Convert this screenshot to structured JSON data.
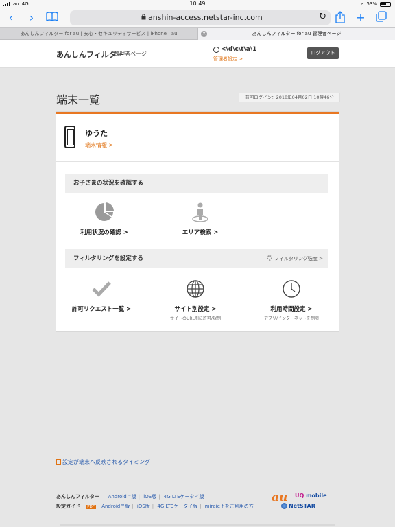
{
  "statusbar": {
    "carrier": "au",
    "network": "4G",
    "time": "10:49",
    "battery": "53%"
  },
  "browser": {
    "url": "anshin-access.netstar-inc.com",
    "tabs": [
      {
        "title": "あんしんフィルター for au | 安心・セキュリティサービス | iPhone | au"
      },
      {
        "title": "あんしんフィルター for au 管理者ページ"
      }
    ]
  },
  "header": {
    "logo": "あんしんフィルター",
    "subtitle": "管理者ページ",
    "user_name": "<\\d\\c\\t\\a\\1",
    "admin_settings": "管理者設定 >",
    "logout": "ログアウト"
  },
  "page": {
    "title": "端末一覧",
    "last_login": "前回ログイン：2018年04月02日 10時46分"
  },
  "device": {
    "name": "ゆうた",
    "info_link": "端末情報 >"
  },
  "section_status": {
    "heading": "お子さまの状況を確認する",
    "items": [
      {
        "label": "利用状況の確認 >",
        "icon": "pie-chart-icon"
      },
      {
        "label": "エリア検索 >",
        "icon": "person-location-icon"
      }
    ]
  },
  "section_filter": {
    "heading": "フィルタリングを設定する",
    "strength_link": "フィルタリング強度 >",
    "items": [
      {
        "label": "許可リクエスト一覧 >",
        "sub": "",
        "icon": "checkmark-icon"
      },
      {
        "label": "サイト別設定 >",
        "sub": "サイトのURL別に許可/規制",
        "icon": "globe-icon"
      },
      {
        "label": "利用時間設定 >",
        "sub": "アプリ/インターネットを制限",
        "icon": "clock-icon"
      }
    ]
  },
  "sync_link": "設定が端末へ反映されるタイミング",
  "footer": {
    "row1_label": "あんしんフィルター",
    "row1_links": [
      "Android™版",
      "iOS版",
      "4G LTEケータイ版"
    ],
    "row2_label": "設定ガイド",
    "pdf_badge": "PDF",
    "row2_links": [
      "Android™版",
      "iOS版",
      "4G LTEケータイ版",
      "miraie f をご利用の方"
    ],
    "brand_au": "au",
    "brand_uq_a": "UQ",
    "brand_uq_b": "mobile",
    "brand_netstar": "NetSTAR"
  },
  "colors": {
    "accent": "#e87722",
    "link": "#2a5cad",
    "logout_bg": "#555555"
  }
}
